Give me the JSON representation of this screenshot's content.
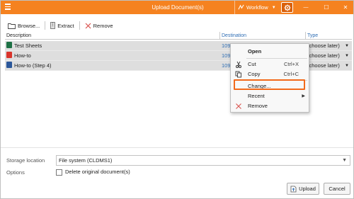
{
  "window": {
    "title": "Upload Document(s)"
  },
  "titlebar": {
    "workflow_label": "Workflow",
    "menu_icon": "hamburger-icon",
    "workflow_icon": "workflow-icon",
    "gear_icon": "gear-icon",
    "minimize_glyph": "—",
    "maximize_glyph": "☐",
    "close_glyph": "✕"
  },
  "toolbar": {
    "browse_label": "Browse...",
    "extract_label": "Extract",
    "remove_label": "Remove"
  },
  "grid": {
    "headers": {
      "description": "Description",
      "destination": "Destination",
      "type": "Type"
    },
    "rows": [
      {
        "description": "Test Sheets",
        "destination": "109",
        "type": "(choose later)",
        "icon": "excel-file-icon"
      },
      {
        "description": "How-to",
        "destination": "109",
        "type": "(choose later)",
        "icon": "pdf-file-icon"
      },
      {
        "description": "How-to (Step 4)",
        "destination": "109",
        "type": "(choose later)",
        "icon": "word-file-icon"
      }
    ]
  },
  "context_menu": {
    "open": "Open",
    "cut": "Cut",
    "cut_shortcut": "Ctrl+X",
    "copy": "Copy",
    "copy_shortcut": "Ctrl+C",
    "change": "Change...",
    "recent": "Recent",
    "remove": "Remove"
  },
  "footer": {
    "storage_label": "Storage location",
    "storage_value": "File system (CLDMS1)",
    "options_label": "Options",
    "delete_original_label": "Delete original document(s)",
    "delete_original_checked": false,
    "upload_label": "Upload",
    "cancel_label": "Cancel"
  },
  "colors": {
    "accent": "#f58220",
    "highlight_border": "#f26a1b",
    "link": "#2e6db4",
    "row_selected": "#dedede"
  }
}
